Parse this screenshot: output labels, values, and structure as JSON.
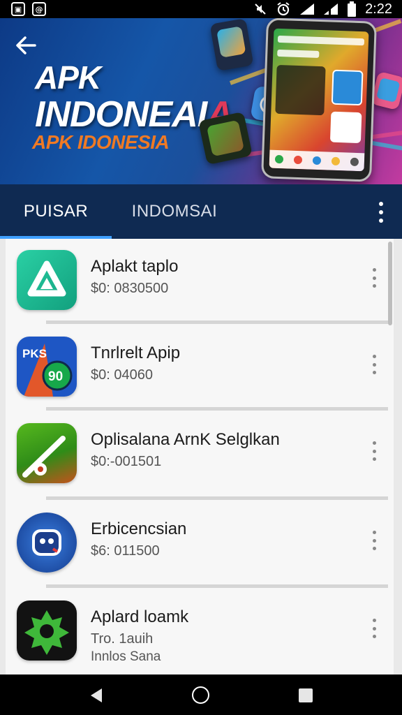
{
  "status_bar": {
    "time": "2:22",
    "left_icons": [
      "photo-notification-icon",
      "app-notification-icon"
    ],
    "right_icons": [
      "mute-icon",
      "alarm-icon",
      "wifi-icon",
      "signal-icon",
      "battery-icon"
    ]
  },
  "banner": {
    "title_line1": "APK",
    "title_line2": "INDONEAI",
    "title_line2_accent": "A",
    "subtitle": "APK IDONESIA",
    "colors": {
      "gradient_start": "#0d3a86",
      "gradient_end": "#c33ba0",
      "subtitle": "#f07a24",
      "accent": "#e03a5a"
    }
  },
  "tabs": {
    "items": [
      {
        "label": "PUISAR",
        "selected": true
      },
      {
        "label": "INDOMSAI",
        "selected": false
      }
    ],
    "indicator_color": "#3fa0ff",
    "background": "#0f2a52"
  },
  "apps": [
    {
      "name": "Aplakt taplo",
      "price": "$0: 0830500",
      "icon": "triangle-app-icon",
      "icon_color": "#1aaf8c"
    },
    {
      "name": "Tnrlrelt Apip",
      "price": "$0: 04060",
      "icon": "pks-90-app-icon",
      "icon_color": "#1e56c4"
    },
    {
      "name": "Oplisalana ArnK Selglkan",
      "price": "$0:-001501",
      "icon": "bat-ball-app-icon",
      "icon_color": "#3aa01c"
    },
    {
      "name": "Erbicencsian",
      "price": "$6: 011500",
      "icon": "robot-face-app-icon",
      "icon_color": "#1f4fa6"
    },
    {
      "name": "Aplard loamk",
      "price": "Tro. 1auih",
      "price_line2": "Innlos Sana",
      "icon": "gear-green-app-icon",
      "icon_color": "#121212"
    }
  ],
  "nav_bar": {
    "icons": [
      "back-icon",
      "home-icon",
      "recents-icon"
    ]
  }
}
